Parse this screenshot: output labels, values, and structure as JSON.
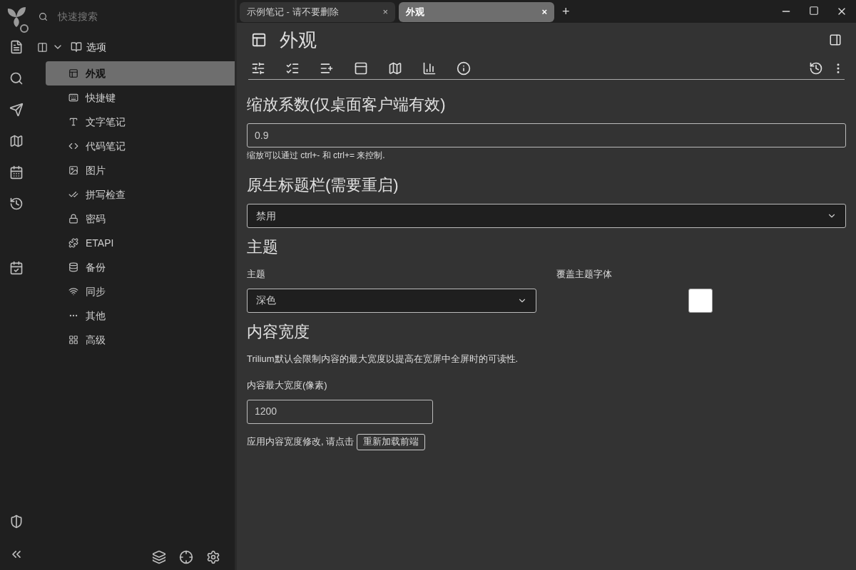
{
  "search": {
    "placeholder": "快速搜索"
  },
  "tree": {
    "root": {
      "label": "选项",
      "expanded": true,
      "children": [
        {
          "label": "外观",
          "selected": true
        },
        {
          "label": "快捷键",
          "selected": false
        },
        {
          "label": "文字笔记",
          "selected": false
        },
        {
          "label": "代码笔记",
          "selected": false
        },
        {
          "label": "图片",
          "selected": false
        },
        {
          "label": "拼写检查",
          "selected": false
        },
        {
          "label": "密码",
          "selected": false
        },
        {
          "label": "ETAPI",
          "selected": false
        },
        {
          "label": "备份",
          "selected": false
        },
        {
          "label": "同步",
          "selected": false
        },
        {
          "label": "其他",
          "selected": false
        },
        {
          "label": "高级",
          "selected": false
        }
      ]
    }
  },
  "tabs": [
    {
      "label": "示例笔记 - 请不要删除",
      "selected": false,
      "close": "×"
    },
    {
      "label": "外观",
      "selected": true,
      "close": "×"
    }
  ],
  "new_tab": "+",
  "note": {
    "title": "外观"
  },
  "sections": [
    {
      "kind": "zoom",
      "heading": "缩放系数(仅桌面客户端有效)",
      "value": "0.9",
      "hint": "缩放可以通过 ctrl+- 和 ctrl+= 来控制."
    },
    {
      "kind": "select",
      "heading": "原生标题栏(需要重启)",
      "value": "禁用"
    },
    {
      "kind": "theme",
      "heading": "主题",
      "select_label": "主题",
      "value": "深色",
      "checkbox_label": "覆盖主题字体",
      "checked": false
    },
    {
      "kind": "width",
      "heading": "内容宽度",
      "description": "Trilium默认会限制内容的最大宽度以提高在宽屏中全屏时的可读性.",
      "field_label": "内容最大宽度(像素)",
      "value": "1200",
      "apply_text": "应用内容宽度修改, 请点击",
      "button": "重新加载前端"
    }
  ]
}
